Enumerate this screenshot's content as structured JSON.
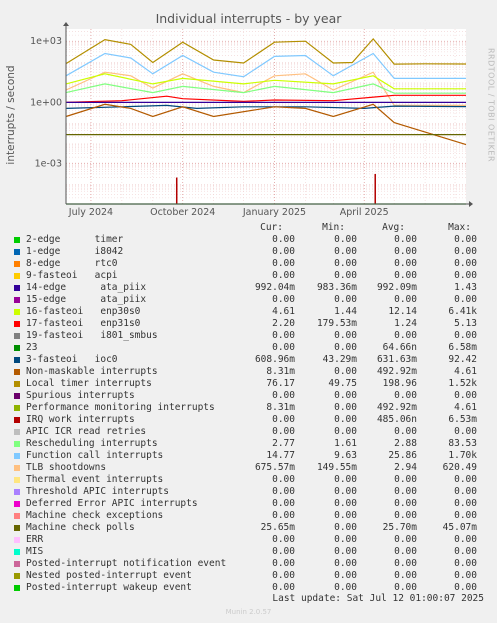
{
  "title": "Individual interrupts - by year",
  "side_text": "RRDTOOL / TOBI OETIKER",
  "ylabel": "interrupts / second",
  "last_update": "Last update: Sat Jul 12 01:00:07 2025",
  "footer": "Munin 2.0.57",
  "legend_headers": {
    "cur": "Cur:",
    "min": "Min:",
    "avg": "Avg:",
    "max": "Max:"
  },
  "legend": [
    {
      "name": "2-edge      timer",
      "color": "#00cc00",
      "cur": "0.00",
      "min": "0.00",
      "avg": "0.00",
      "max": "0.00"
    },
    {
      "name": "1-edge      i8042",
      "color": "#0066b3",
      "cur": "0.00",
      "min": "0.00",
      "avg": "0.00",
      "max": "0.00"
    },
    {
      "name": "8-edge      rtc0",
      "color": "#ff8000",
      "cur": "0.00",
      "min": "0.00",
      "avg": "0.00",
      "max": "0.00"
    },
    {
      "name": "9-fasteoi   acpi",
      "color": "#ffcc00",
      "cur": "0.00",
      "min": "0.00",
      "avg": "0.00",
      "max": "0.00"
    },
    {
      "name": "14-edge      ata_piix",
      "color": "#330099",
      "cur": "992.04m",
      "min": "983.36m",
      "avg": "992.09m",
      "max": "1.43"
    },
    {
      "name": "15-edge      ata_piix",
      "color": "#990099",
      "cur": "0.00",
      "min": "0.00",
      "avg": "0.00",
      "max": "0.00"
    },
    {
      "name": "16-fasteoi   enp30s0",
      "color": "#ccff00",
      "cur": "4.61",
      "min": "1.44",
      "avg": "12.14",
      "max": "6.41k"
    },
    {
      "name": "17-fasteoi   enp31s0",
      "color": "#ff0000",
      "cur": "2.20",
      "min": "179.53m",
      "avg": "1.24",
      "max": "5.13"
    },
    {
      "name": "19-fasteoi   i801_smbus",
      "color": "#808080",
      "cur": "0.00",
      "min": "0.00",
      "avg": "0.00",
      "max": "0.00"
    },
    {
      "name": "23",
      "color": "#008f00",
      "cur": "0.00",
      "min": "0.00",
      "avg": "64.66n",
      "max": "6.58m"
    },
    {
      "name": "3-fasteoi   ioc0",
      "color": "#00487d",
      "cur": "608.96m",
      "min": "43.29m",
      "avg": "631.63m",
      "max": "92.42"
    },
    {
      "name": "Non-maskable interrupts",
      "color": "#b35a00",
      "cur": "8.31m",
      "min": "0.00",
      "avg": "492.92m",
      "max": "4.61"
    },
    {
      "name": "Local timer interrupts",
      "color": "#b38f00",
      "cur": "76.17",
      "min": "49.75",
      "avg": "198.96",
      "max": "1.52k"
    },
    {
      "name": "Spurious interrupts",
      "color": "#6b006b",
      "cur": "0.00",
      "min": "0.00",
      "avg": "0.00",
      "max": "0.00"
    },
    {
      "name": "Performance monitoring interrupts",
      "color": "#8fb300",
      "cur": "8.31m",
      "min": "0.00",
      "avg": "492.92m",
      "max": "4.61"
    },
    {
      "name": "IRQ work interrupts",
      "color": "#b30000",
      "cur": "0.00",
      "min": "0.00",
      "avg": "485.06n",
      "max": "6.53m"
    },
    {
      "name": "APIC ICR read retries",
      "color": "#bebebe",
      "cur": "0.00",
      "min": "0.00",
      "avg": "0.00",
      "max": "0.00"
    },
    {
      "name": "Rescheduling interrupts",
      "color": "#80ff80",
      "cur": "2.77",
      "min": "1.61",
      "avg": "2.88",
      "max": "83.53"
    },
    {
      "name": "Function call interrupts",
      "color": "#80c9ff",
      "cur": "14.77",
      "min": "9.63",
      "avg": "25.86",
      "max": "1.70k"
    },
    {
      "name": "TLB shootdowns",
      "color": "#ffc080",
      "cur": "675.57m",
      "min": "149.55m",
      "avg": "2.94",
      "max": "620.49"
    },
    {
      "name": "Thermal event interrupts",
      "color": "#ffe680",
      "cur": "0.00",
      "min": "0.00",
      "avg": "0.00",
      "max": "0.00"
    },
    {
      "name": "Threshold APIC interrupts",
      "color": "#aa80ff",
      "cur": "0.00",
      "min": "0.00",
      "avg": "0.00",
      "max": "0.00"
    },
    {
      "name": "Deferred Error APIC interrupts",
      "color": "#ee00cc",
      "cur": "0.00",
      "min": "0.00",
      "avg": "0.00",
      "max": "0.00"
    },
    {
      "name": "Machine check exceptions",
      "color": "#ff8080",
      "cur": "0.00",
      "min": "0.00",
      "avg": "0.00",
      "max": "0.00"
    },
    {
      "name": "Machine check polls",
      "color": "#666600",
      "cur": "25.65m",
      "min": "0.00",
      "avg": "25.70m",
      "max": "45.07m"
    },
    {
      "name": "ERR",
      "color": "#ffbfff",
      "cur": "0.00",
      "min": "0.00",
      "avg": "0.00",
      "max": "0.00"
    },
    {
      "name": "MIS",
      "color": "#00ffcc",
      "cur": "0.00",
      "min": "0.00",
      "avg": "0.00",
      "max": "0.00"
    },
    {
      "name": "Posted-interrupt notification event",
      "color": "#cc6699",
      "cur": "0.00",
      "min": "0.00",
      "avg": "0.00",
      "max": "0.00"
    },
    {
      "name": "Nested posted-interrupt event",
      "color": "#999900",
      "cur": "0.00",
      "min": "0.00",
      "avg": "0.00",
      "max": "0.00"
    },
    {
      "name": "Posted-interrupt wakeup event",
      "color": "#00cc00",
      "cur": "0.00",
      "min": "0.00",
      "avg": "0.00",
      "max": "0.00"
    }
  ],
  "chart_data": {
    "type": "line",
    "title": "Individual interrupts - by year",
    "ylabel": "interrupts / second",
    "yscale": "log",
    "ylim": [
      1e-05,
      4000
    ],
    "xlim": [
      "2024-06-06",
      "2025-07-12"
    ],
    "xticks": [
      {
        "label": "July 2024",
        "date": "2024-07-01"
      },
      {
        "label": "October 2024",
        "date": "2024-10-01"
      },
      {
        "label": "January 2025",
        "date": "2025-01-01"
      },
      {
        "label": "April 2025",
        "date": "2025-04-01"
      }
    ],
    "yticks": [
      {
        "label": "1e-03",
        "value": 0.001
      },
      {
        "label": "1e+00",
        "value": 1
      },
      {
        "label": "1e+03",
        "value": 1000
      }
    ],
    "grid": true,
    "series": [
      {
        "name": "Local timer interrupts",
        "color": "#b38f00",
        "x": [
          "2024-06-06",
          "2024-07-15",
          "2024-08-10",
          "2024-09-01",
          "2024-10-01",
          "2024-11-01",
          "2024-12-01",
          "2025-01-01",
          "2025-02-01",
          "2025-03-01",
          "2025-03-20",
          "2025-04-10",
          "2025-05-01",
          "2025-06-01",
          "2025-07-12"
        ],
        "y": [
          80,
          1200,
          700,
          90,
          900,
          120,
          85,
          900,
          1000,
          85,
          90,
          1300,
          75,
          78,
          76
        ]
      },
      {
        "name": "Function call interrupts",
        "color": "#80c9ff",
        "x": [
          "2024-06-06",
          "2024-07-15",
          "2024-08-10",
          "2024-09-01",
          "2024-10-01",
          "2024-11-01",
          "2024-12-01",
          "2025-01-01",
          "2025-02-01",
          "2025-03-01",
          "2025-04-10",
          "2025-05-01",
          "2025-06-01",
          "2025-07-12"
        ],
        "y": [
          20,
          250,
          150,
          25,
          200,
          30,
          18,
          180,
          200,
          20,
          250,
          15,
          15,
          15
        ]
      },
      {
        "name": "TLB shootdowns",
        "color": "#ffc080",
        "x": [
          "2024-06-06",
          "2024-07-15",
          "2024-08-10",
          "2024-09-01",
          "2024-10-01",
          "2024-11-01",
          "2024-12-01",
          "2025-01-01",
          "2025-02-01",
          "2025-03-01",
          "2025-04-10",
          "2025-05-01",
          "2025-06-01",
          "2025-07-12"
        ],
        "y": [
          4,
          30,
          20,
          5,
          25,
          6,
          3,
          20,
          25,
          4,
          30,
          0.7,
          0.7,
          0.7
        ]
      },
      {
        "name": "Rescheduling interrupts",
        "color": "#80ff80",
        "x": [
          "2024-06-06",
          "2024-07-15",
          "2024-09-01",
          "2024-10-01",
          "2024-12-01",
          "2025-01-01",
          "2025-03-01",
          "2025-04-10",
          "2025-05-01",
          "2025-07-12"
        ],
        "y": [
          3,
          8,
          3,
          6,
          3,
          6,
          3,
          8,
          2.8,
          2.8
        ]
      },
      {
        "name": "16-fasteoi   enp30s0",
        "color": "#ccff00",
        "x": [
          "2024-06-06",
          "2024-07-15",
          "2024-09-01",
          "2024-10-01",
          "2024-12-01",
          "2025-01-01",
          "2025-03-01",
          "2025-04-10",
          "2025-05-01",
          "2025-07-12"
        ],
        "y": [
          8,
          25,
          8,
          15,
          8,
          12,
          8,
          20,
          4.6,
          4.6
        ]
      },
      {
        "name": "17-fasteoi   enp31s0",
        "color": "#ff0000",
        "x": [
          "2024-06-06",
          "2024-08-01",
          "2024-09-15",
          "2024-10-01",
          "2024-12-01",
          "2025-01-01",
          "2025-03-01",
          "2025-05-01",
          "2025-07-12"
        ],
        "y": [
          1,
          1.2,
          2,
          1.5,
          1.1,
          1.3,
          1.2,
          2.2,
          2.2
        ]
      },
      {
        "name": "14-edge      ata_piix",
        "color": "#330099",
        "x": [
          "2024-06-06",
          "2025-07-12"
        ],
        "y": [
          0.99,
          0.99
        ]
      },
      {
        "name": "3-fasteoi   ioc0",
        "color": "#00487d",
        "x": [
          "2024-06-06",
          "2024-08-01",
          "2024-09-15",
          "2024-10-15",
          "2024-12-01",
          "2025-02-01",
          "2025-04-01",
          "2025-05-01",
          "2025-07-12"
        ],
        "y": [
          0.5,
          0.6,
          0.7,
          0.5,
          0.6,
          0.6,
          0.5,
          0.65,
          0.61
        ]
      },
      {
        "name": "Non-maskable interrupts",
        "color": "#b35a00",
        "x": [
          "2024-06-06",
          "2024-07-15",
          "2024-08-10",
          "2024-09-01",
          "2024-10-01",
          "2024-11-01",
          "2025-01-01",
          "2025-02-01",
          "2025-03-01",
          "2025-04-10",
          "2025-05-01",
          "2025-07-12"
        ],
        "y": [
          0.2,
          0.8,
          0.5,
          0.2,
          0.6,
          0.2,
          0.6,
          0.5,
          0.2,
          0.8,
          0.1,
          0.0083
        ]
      },
      {
        "name": "Machine check polls",
        "color": "#666600",
        "x": [
          "2024-06-06",
          "2025-07-12"
        ],
        "y": [
          0.0257,
          0.0257
        ]
      },
      {
        "name": "IRQ work interrupts",
        "color": "#b30000",
        "x": [
          "2024-09-25",
          "2024-09-27",
          "2025-04-12",
          "2025-04-14"
        ],
        "y": [
          0.0002,
          2e-05,
          0.0003,
          2e-05
        ]
      },
      {
        "name": "23",
        "color": "#008f00",
        "x": [
          "2024-06-06",
          "2025-07-12"
        ],
        "y": [
          1e-05,
          1e-05
        ]
      }
    ]
  }
}
